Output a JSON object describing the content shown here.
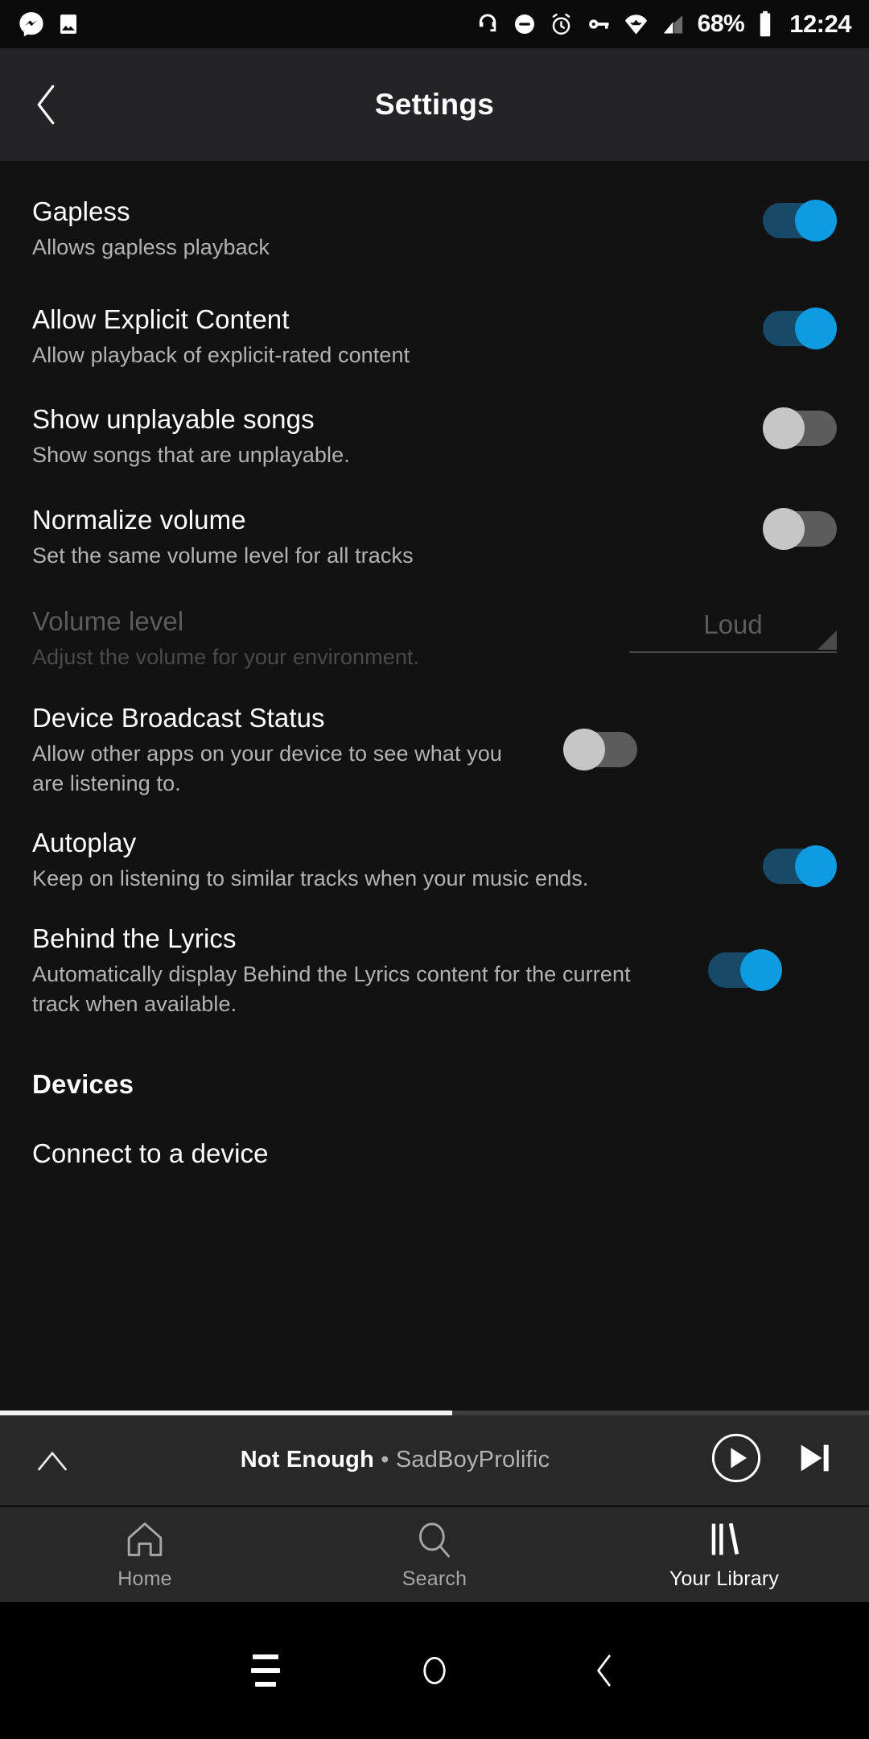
{
  "status_bar": {
    "left_icons": [
      "messenger-icon",
      "photos-icon"
    ],
    "right_icons": [
      "headphones-icon",
      "do-not-disturb-icon",
      "alarm-icon",
      "vpn-key-icon",
      "wifi-icon",
      "cellular-signal-icon"
    ],
    "battery_percent": "68%",
    "clock": "12:24"
  },
  "header": {
    "title": "Settings",
    "back_icon": "chevron-left-icon"
  },
  "settings": {
    "rows": [
      {
        "title": "Gapless",
        "subtitle": "Allows gapless playback",
        "control": "toggle",
        "value": "on",
        "disabled": false
      },
      {
        "title": "Allow Explicit Content",
        "subtitle": "Allow playback of explicit-rated content",
        "control": "toggle",
        "value": "on",
        "disabled": false
      },
      {
        "title": "Show unplayable songs",
        "subtitle": "Show songs that are unplayable.",
        "control": "toggle",
        "value": "off",
        "disabled": false
      },
      {
        "title": "Normalize volume",
        "subtitle": "Set the same volume level for all tracks",
        "control": "toggle",
        "value": "off",
        "disabled": false
      },
      {
        "title": "Volume level",
        "subtitle": "Adjust the volume for your environment.",
        "control": "spinner",
        "value": "Loud",
        "disabled": true
      },
      {
        "title": "Device Broadcast Status",
        "subtitle": "Allow other apps on your device to see what you are listening to.",
        "control": "toggle",
        "value": "off",
        "disabled": false
      },
      {
        "title": "Autoplay",
        "subtitle": "Keep on listening to similar tracks when your music ends.",
        "control": "toggle",
        "value": "on",
        "disabled": false
      },
      {
        "title": "Behind the Lyrics",
        "subtitle": "Automatically display Behind the Lyrics content for the current track when available.",
        "control": "toggle",
        "value": "on",
        "disabled": false
      }
    ],
    "section_devices": "Devices",
    "connect_to_device": "Connect to a device"
  },
  "now_playing": {
    "expand_icon": "chevron-up-icon",
    "track": "Not Enough",
    "separator": "•",
    "artist": "SadBoyProlific",
    "play_icon": "play-circle-icon",
    "next_icon": "skip-next-icon",
    "progress_percent": 52
  },
  "tabs": [
    {
      "label": "Home",
      "icon": "home-icon",
      "active": false
    },
    {
      "label": "Search",
      "icon": "search-icon",
      "active": false
    },
    {
      "label": "Your Library",
      "icon": "library-icon",
      "active": true
    }
  ],
  "android_nav": {
    "recents_icon": "recents-icon",
    "home_icon": "home-circle-icon",
    "back_icon": "back-chevron-icon"
  },
  "colors": {
    "accent_blue": "#0f9bdf",
    "track_on": "#174a68",
    "track_off": "#5c5c5c",
    "thumb_off": "#c6c6c6",
    "bg": "#121212",
    "header_bg": "#242428",
    "bar_bg": "#282828",
    "text_secondary": "#b3b3b3"
  }
}
